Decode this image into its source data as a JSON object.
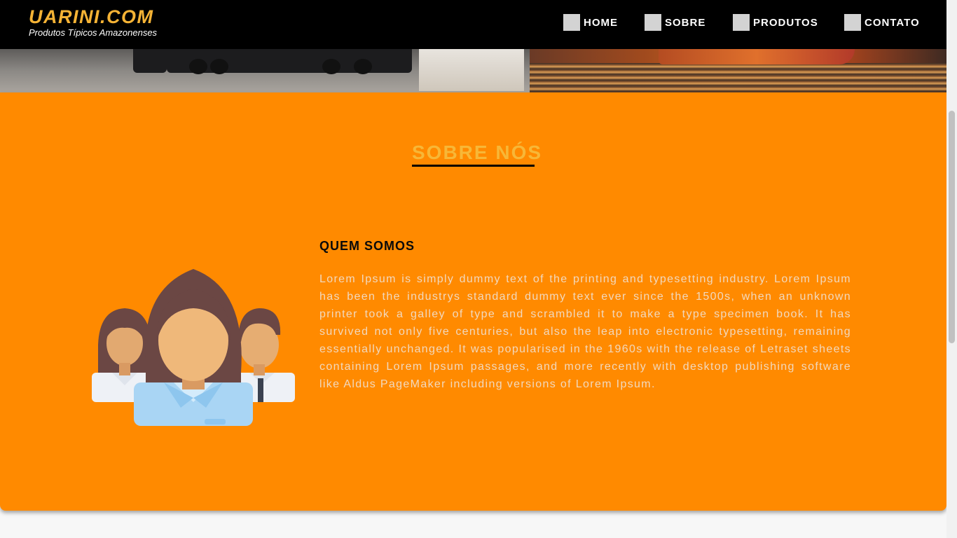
{
  "site": {
    "brand_title": "UARINI.COM",
    "brand_subtitle": "Produtos Típicos Amazonenses"
  },
  "nav": {
    "items": [
      {
        "label": "HOME",
        "icon": "placeholder-icon"
      },
      {
        "label": "SOBRE",
        "icon": "placeholder-icon"
      },
      {
        "label": "PRODUTOS",
        "icon": "placeholder-icon"
      },
      {
        "label": "CONTATO",
        "icon": "placeholder-icon"
      }
    ]
  },
  "hero": {
    "image": "trucks-and-cargo-ship-photo"
  },
  "about": {
    "title": "SOBRE NÓS",
    "subtitle": "QUEM SOMOS",
    "illustration": "team-people-icon",
    "text": "Lorem Ipsum is simply dummy text of the printing and typesetting industry. Lorem Ipsum has been the industrys standard dummy text ever since the 1500s, when an unknown printer took a galley of type and scrambled it to make a type specimen book. It has survived not only five centuries, but also the leap into electronic typesetting, remaining essentially unchanged. It was popularised in the 1960s with the release of Letraset sheets containing Lorem Ipsum passages, and more recently with desktop publishing software like Aldus PageMaker including versions of Lorem Ipsum."
  },
  "colors": {
    "navbar_bg": "#000000",
    "brand": "#f5b335",
    "section_bg": "#ff8a00",
    "section_title": "#f7b737",
    "body_text": "#f1d9bf"
  }
}
